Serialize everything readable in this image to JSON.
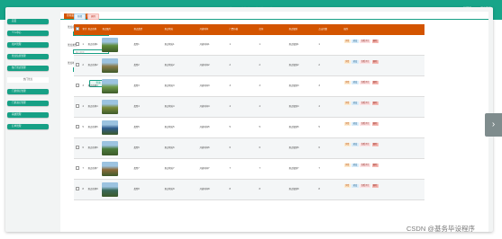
{
  "header": {
    "title": "基于SSM的旅游景点信息管理系统",
    "user": "管理员 admin 退出登录"
  },
  "sidebar": {
    "items": [
      {
        "label": "首页",
        "type": "item"
      },
      {
        "label": "个人中心",
        "type": "item"
      },
      {
        "label": "用户管理",
        "type": "item"
      },
      {
        "label": "景点信息管理",
        "type": "item"
      },
      {
        "label": "热门景点管理",
        "type": "item"
      },
      {
        "label": "热门景点",
        "type": "sub"
      },
      {
        "label": "门票预订管理",
        "type": "item"
      },
      {
        "label": "门票退订管理",
        "type": "item"
      },
      {
        "label": "系统管理",
        "type": "item"
      },
      {
        "label": "订单管理",
        "type": "item"
      }
    ]
  },
  "tabs": [
    "控制面板",
    "热门景点"
  ],
  "filter": {
    "field1_label": "景点名称",
    "field1_placeholder": "景点名称",
    "field2_label": "景点类型",
    "field2_placeholder": "景点类型",
    "field3_label": "景点地址",
    "field3_placeholder": "景点地址",
    "search_label": "查询"
  },
  "actions": {
    "add": "新增",
    "delete": "删除"
  },
  "table": {
    "headers": [
      "",
      "索引",
      "景点名称",
      "景点图片",
      "景点类型",
      "景点地址",
      "开放时间",
      "门票价格",
      "库存",
      "景点级别",
      "点击次数",
      "操作"
    ],
    "rows": [
      {
        "index": "1",
        "name": "景点名称1",
        "type": "类型1",
        "address": "景点地址1",
        "time": "开放时间1",
        "price": "1",
        "stock": "1",
        "level": "景点级别1",
        "clicks": "1"
      },
      {
        "index": "2",
        "name": "景点名称2",
        "type": "类型2",
        "address": "景点地址2",
        "time": "开放时间2",
        "price": "2",
        "stock": "2",
        "level": "景点级别2",
        "clicks": "2"
      },
      {
        "index": "3",
        "name": "景点名称3",
        "type": "类型3",
        "address": "景点地址3",
        "time": "开放时间3",
        "price": "3",
        "stock": "3",
        "level": "景点级别3",
        "clicks": "3"
      },
      {
        "index": "4",
        "name": "景点名称4",
        "type": "类型4",
        "address": "景点地址4",
        "time": "开放时间4",
        "price": "4",
        "stock": "4",
        "level": "景点级别4",
        "clicks": "4"
      },
      {
        "index": "5",
        "name": "景点名称5",
        "type": "类型5",
        "address": "景点地址5",
        "time": "开放时间5",
        "price": "5",
        "stock": "5",
        "level": "景点级别5",
        "clicks": "5"
      },
      {
        "index": "6",
        "name": "景点名称6",
        "type": "类型6",
        "address": "景点地址6",
        "time": "开放时间6",
        "price": "6",
        "stock": "6",
        "level": "景点级别6",
        "clicks": "6"
      },
      {
        "index": "7",
        "name": "景点名称7",
        "type": "类型7",
        "address": "景点地址7",
        "time": "开放时间7",
        "price": "7",
        "stock": "7",
        "level": "景点级别7",
        "clicks": "7"
      },
      {
        "index": "8",
        "name": "景点名称8",
        "type": "类型8",
        "address": "景点地址8",
        "time": "开放时间8",
        "price": "8",
        "stock": "8",
        "level": "景点级别8",
        "clicks": "8"
      }
    ],
    "op_labels": {
      "detail": "详情",
      "edit": "修改",
      "reply": "查看评论",
      "delete": "删除"
    }
  },
  "thumb_colors": [
    "#5d8a3a",
    "#8a7a4a",
    "#6e9a4a",
    "#7a8a3a",
    "#2e5a8a",
    "#4a7a3a",
    "#8a6a3a",
    "#3a6a5a"
  ],
  "colors": {
    "accent": "#16a085",
    "header": "#d35400"
  },
  "nav_arrow": "›",
  "watermark": "CSDN @基务毕设程序"
}
